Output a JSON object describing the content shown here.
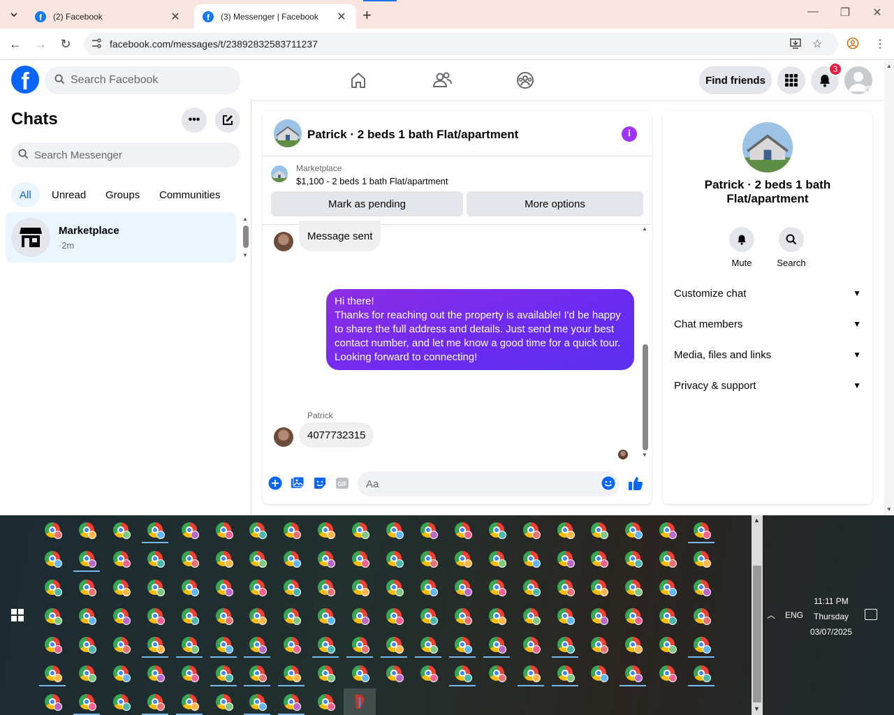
{
  "browser": {
    "tabs": [
      {
        "title": "(2) Facebook",
        "active": false
      },
      {
        "title": "(3) Messenger | Facebook",
        "active": true
      }
    ],
    "url": "facebook.com/messages/t/23892832583711237"
  },
  "fb_nav": {
    "search_placeholder": "Search Facebook",
    "find_friends": "Find friends",
    "notifications_count": "3"
  },
  "sidebar": {
    "title": "Chats",
    "search_placeholder": "Search Messenger",
    "filters": [
      "All",
      "Unread",
      "Groups",
      "Communities"
    ],
    "active_filter": "All",
    "chats": [
      {
        "name": "Marketplace",
        "preview": "·2m"
      }
    ]
  },
  "conversation": {
    "title": "Patrick · 2 beds 1 bath Flat/apartment",
    "marketplace_label": "Marketplace",
    "listing": "$1,100 - 2 beds 1 bath Flat/apartment",
    "mark_pending": "Mark as pending",
    "more_options": "More options",
    "messages": [
      {
        "from": "Patrick",
        "text": "Message sent",
        "outgoing": false
      },
      {
        "from": "me",
        "text": "Hi there!\nThanks for reaching out the property is available! I'd be happy to share the full address and details. Just send me your best contact number, and let me know a good time for a quick tour. Looking forward to connecting!",
        "outgoing": true
      },
      {
        "from": "Patrick",
        "text": "4077732315",
        "outgoing": false
      }
    ],
    "sender_label": "Patrick",
    "composer_placeholder": "Aa"
  },
  "info_panel": {
    "name": "Patrick · 2 beds 1 bath Flat/apartment",
    "mute": "Mute",
    "search": "Search",
    "sections": [
      "Customize chat",
      "Chat members",
      "Media, files and links",
      "Privacy & support"
    ]
  },
  "taskbar": {
    "language": "ENG",
    "time": "11:11 PM",
    "day": "Thursday",
    "date": "03/07/2025"
  },
  "colors": {
    "fb_blue": "#0866ff",
    "messenger_purple": "#a033ff",
    "notification_red": "#e41e3f",
    "tab_strip": "#fbe5e1"
  }
}
